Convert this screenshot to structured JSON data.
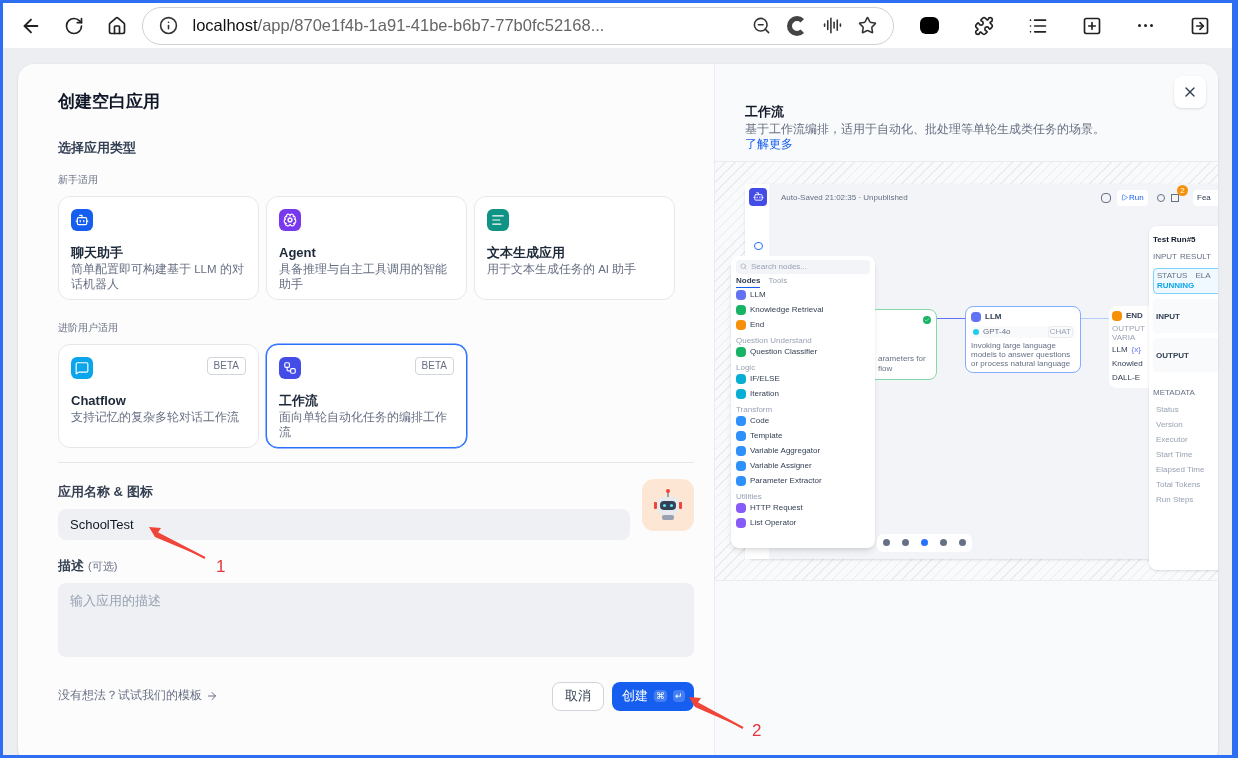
{
  "browser": {
    "url_host": "localhost",
    "url_path": "/app/870e1f4b-1a91-41be-b6b7-77b0fc52168..."
  },
  "dialog": {
    "title": "创建空白应用",
    "section_label": "选择应用类型",
    "groups": [
      {
        "label": "新手适用",
        "types": [
          {
            "kind": "chatbot",
            "name": "聊天助手",
            "description": "简单配置即可构建基于 LLM 的对话机器人",
            "selected": false
          },
          {
            "kind": "agent",
            "name": "Agent",
            "description": "具备推理与自主工具调用的智能助手",
            "selected": false
          },
          {
            "kind": "completion",
            "name": "文本生成应用",
            "description": "用于文本生成任务的 AI 助手",
            "selected": false
          }
        ]
      },
      {
        "label": "进阶用户适用",
        "types": [
          {
            "kind": "chatflow",
            "name": "Chatflow",
            "badge": "BETA",
            "description": "支持记忆的复杂多轮对话工作流",
            "selected": false
          },
          {
            "kind": "workflow",
            "name": "工作流",
            "badge": "BETA",
            "description": "面向单轮自动化任务的编排工作流",
            "selected": true
          }
        ]
      }
    ],
    "name_label": "应用名称 & 图标",
    "name_value": "SchoolTest",
    "desc_label": "描述",
    "desc_optional": "(可选)",
    "desc_placeholder": "输入应用的描述",
    "template_link": "没有想法？试试我们的模板",
    "cancel": "取消",
    "create": "创建",
    "shortcut": [
      "⌘",
      "↵"
    ]
  },
  "preview": {
    "title": "工作流",
    "description": "基于工作流编排，适用于自动化、批处理等单轮生成类任务的场景。",
    "link": "了解更多"
  },
  "editor": {
    "status": "Auto-Saved 21:02:35 · Unpublished",
    "run": "Run",
    "badge": "2",
    "features": "Fea",
    "palette": {
      "placeholder": "Search nodes...",
      "tabs": [
        {
          "label": "Nodes",
          "selected": true
        },
        {
          "label": "Tools",
          "selected": false
        }
      ],
      "groups": [
        {
          "items": [
            {
              "label": "LLM",
              "color": "#6172f3"
            },
            {
              "label": "Knowledge Retrieval",
              "color": "#16b364"
            },
            {
              "label": "End",
              "color": "#f79009"
            }
          ]
        },
        {
          "label": "Question Understand",
          "items": [
            {
              "label": "Question Classifier",
              "color": "#16b364"
            }
          ]
        },
        {
          "label": "Logic",
          "items": [
            {
              "label": "IF/ELSE",
              "color": "#06aed4"
            },
            {
              "label": "Iteration",
              "color": "#06aed4"
            }
          ]
        },
        {
          "label": "Transform",
          "items": [
            {
              "label": "Code",
              "color": "#2e90fa"
            },
            {
              "label": "Template",
              "color": "#2e90fa"
            },
            {
              "label": "Variable Aggregator",
              "color": "#2e90fa"
            },
            {
              "label": "Variable Assigner",
              "color": "#2e90fa"
            },
            {
              "label": "Parameter Extractor",
              "color": "#2e90fa"
            }
          ]
        },
        {
          "label": "Utilities",
          "items": [
            {
              "label": "HTTP Request",
              "color": "#875bf7"
            },
            {
              "label": "List Operator",
              "color": "#875bf7"
            }
          ]
        }
      ]
    },
    "start_node": {
      "lines": [
        "arameters for",
        "flow"
      ]
    },
    "llm_node": {
      "title": "LLM",
      "model": "GPT-4o",
      "mode": "CHAT",
      "description": "Invoking large language models to answer questions or process natural language"
    },
    "end_node": {
      "title": "END",
      "label": "OUTPUT VARIA",
      "var_tag": "{x}",
      "outputs": [
        "LLM",
        "Knowled",
        "DALL-E"
      ]
    },
    "test_run": {
      "title": "Test Run#5",
      "tabs": [
        "INPUT",
        "RESULT"
      ],
      "status_label": "STATUS",
      "elapsed_label": "ELA",
      "status": "RUNNING",
      "input": "INPUT",
      "output": "OUTPUT",
      "metadata": "METADATA",
      "fields": [
        "Status",
        "Version",
        "Executor",
        "Start Time",
        "Elapsed Time",
        "Total Tokens",
        "Run Steps"
      ]
    }
  },
  "annotations": [
    {
      "label": "1"
    },
    {
      "label": "2"
    }
  ]
}
